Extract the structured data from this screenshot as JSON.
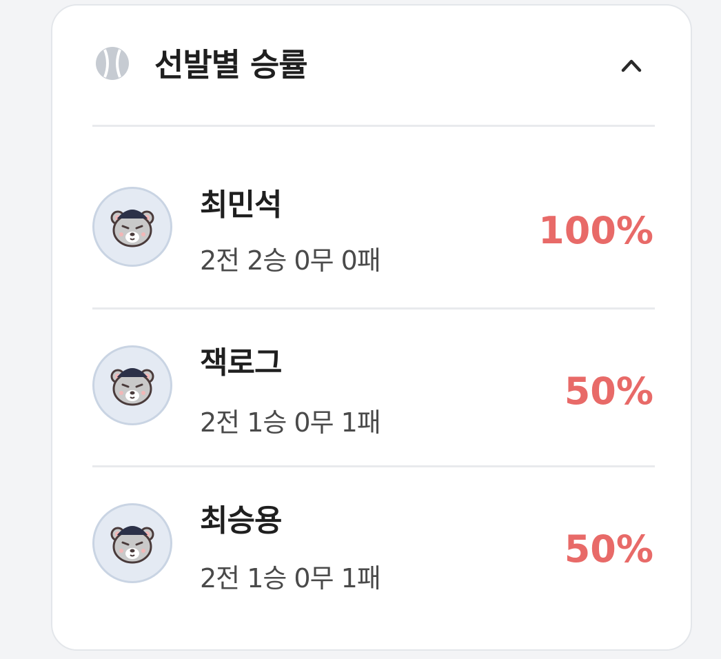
{
  "card": {
    "title": "선발별 승률",
    "header_icon": "baseball-icon",
    "collapse_icon": "chevron-up-icon"
  },
  "pitchers": [
    {
      "name": "최민석",
      "record": "2전 2승 0무 0패",
      "win_rate": "100%"
    },
    {
      "name": "잭로그",
      "record": "2전 1승 0무 1패",
      "win_rate": "50%"
    },
    {
      "name": "최승용",
      "record": "2전 1승 0무 1패",
      "win_rate": "50%"
    }
  ],
  "colors": {
    "win_rate": "#e86a68",
    "avatar_bg": "#e4eaf3",
    "avatar_border": "#c9d4e3",
    "card_bg": "#ffffff",
    "page_bg": "#f3f4f6"
  }
}
